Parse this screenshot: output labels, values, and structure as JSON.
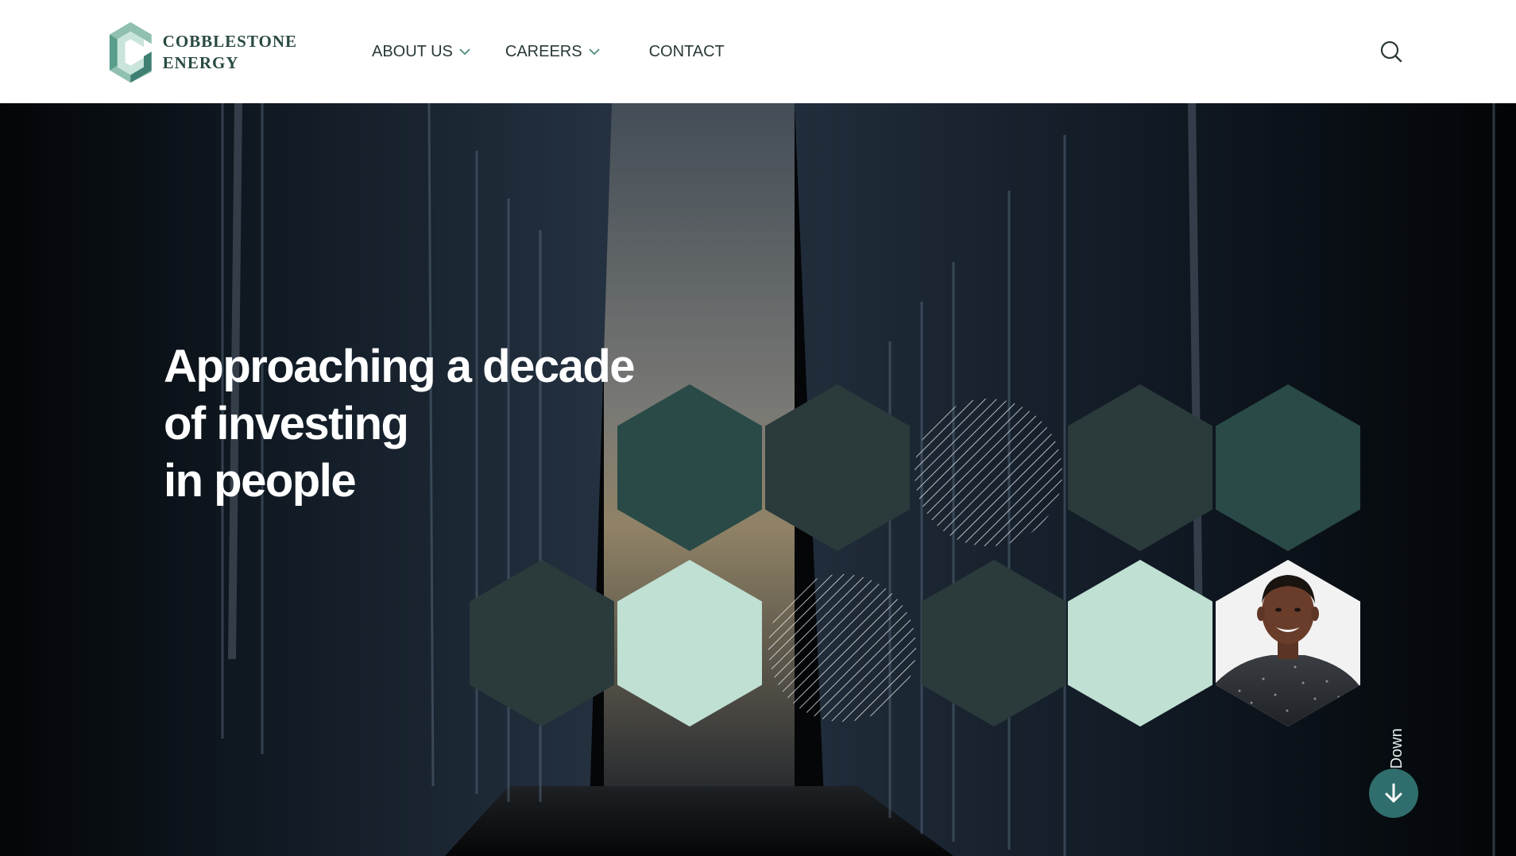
{
  "brand": {
    "line1": "COBBLESTONE",
    "line2": "ENERGY",
    "logo_icon": "cobblestone-hex-logo"
  },
  "nav": {
    "items": [
      {
        "label": "ABOUT US",
        "has_dropdown": true
      },
      {
        "label": "CAREERS",
        "has_dropdown": true
      },
      {
        "label": "CONTACT",
        "has_dropdown": false
      }
    ],
    "search_icon": "search-icon"
  },
  "hero": {
    "headline": [
      "Approaching a decade",
      "of investing",
      "in people"
    ],
    "scroll_label": "Scroll Down",
    "scroll_icon": "arrow-down-icon"
  },
  "colors": {
    "deep_teal": "#294a47",
    "charcoal": "#2b3a3b",
    "mint": "#bfe0d3",
    "accent_button": "#2f6e6c",
    "logo_text": "#2a4a44"
  }
}
